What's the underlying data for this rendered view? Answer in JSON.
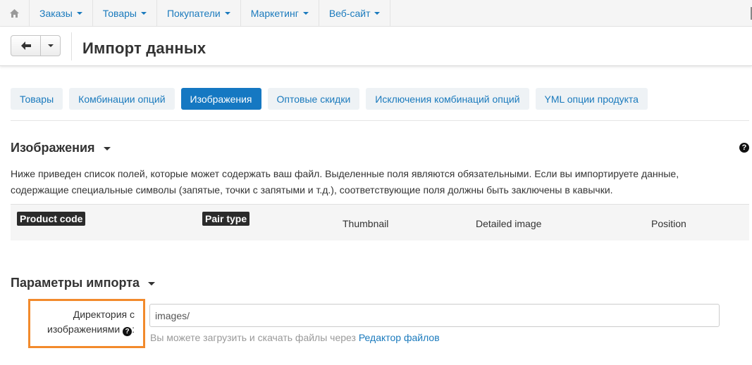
{
  "topmenu": {
    "home_icon": "home-icon",
    "items": [
      {
        "label": "Заказы"
      },
      {
        "label": "Товары"
      },
      {
        "label": "Покупатели"
      },
      {
        "label": "Маркетинг"
      },
      {
        "label": "Веб-сайт"
      }
    ]
  },
  "header": {
    "back_icon": "arrow-left-icon",
    "title": "Импорт данных"
  },
  "tabs": [
    {
      "label": "Товары",
      "active": false
    },
    {
      "label": "Комбинации опций",
      "active": false
    },
    {
      "label": "Изображения",
      "active": true
    },
    {
      "label": "Оптовые скидки",
      "active": false
    },
    {
      "label": "Исключения комбинаций опций",
      "active": false
    },
    {
      "label": "YML опции продукта",
      "active": false
    }
  ],
  "images_section": {
    "title": "Изображения",
    "help_glyph": "?",
    "description_line1": "Ниже приведен список полей, которые может содержать ваш файл. Выделенные поля являются обязательными. Если вы импортируете данные,",
    "description_line2": "содержащие специальные символы (запятые, точки с запятыми и т.д.), соответствующие поля должны быть заключены в кавычки.",
    "fields": [
      {
        "label": "Product code",
        "required": true
      },
      {
        "label": "Pair type",
        "required": true
      },
      {
        "label": "Thumbnail",
        "required": false
      },
      {
        "label": "Detailed image",
        "required": false
      },
      {
        "label": "Position",
        "required": false
      }
    ]
  },
  "import_params": {
    "title": "Параметры импорта",
    "images_dir_label_line1": "Директория с",
    "images_dir_label_line2": "изображениями",
    "label_colon": ":",
    "help_glyph": "?",
    "images_dir_value": "images/",
    "hint_text": "Вы можете загрузить и скачать файлы через ",
    "hint_link": "Редактор файлов"
  },
  "colors": {
    "accent": "#1578c2",
    "link": "#1a7abd",
    "highlight_border": "#f28a2c"
  }
}
